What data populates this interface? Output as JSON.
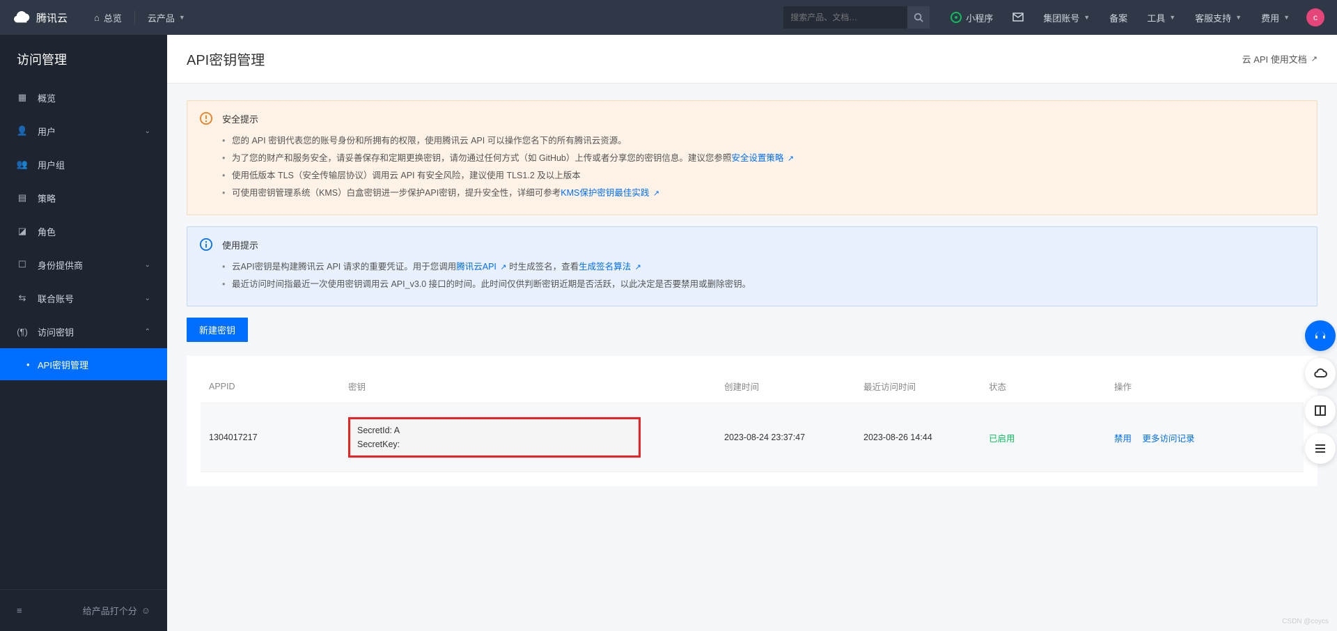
{
  "header": {
    "brand": "腾讯云",
    "overview": "总览",
    "products": "云产品",
    "search_placeholder": "搜索产品、文档…",
    "miniapp": "小程序",
    "group_account": "集团账号",
    "filing": "备案",
    "tools": "工具",
    "support": "客服支持",
    "cost": "费用",
    "avatar_letter": "c"
  },
  "sidebar": {
    "title": "访问管理",
    "items": {
      "overview": "概览",
      "users": "用户",
      "user_groups": "用户组",
      "policies": "策略",
      "roles": "角色",
      "idp": "身份提供商",
      "federated": "联合账号",
      "access_key": "访问密钥",
      "api_key_mgmt": "API密钥管理"
    },
    "footer_rate": "给产品打个分",
    "collapse_icon": "≡"
  },
  "page": {
    "title": "API密钥管理",
    "doc_link": "云 API 使用文档"
  },
  "warn_alert": {
    "title": "安全提示",
    "l1": "您的 API 密钥代表您的账号身份和所拥有的权限，使用腾讯云 API 可以操作您名下的所有腾讯云资源。",
    "l2a": "为了您的财产和服务安全，请妥善保存和定期更换密钥，请勿通过任何方式（如 GitHub）上传或者分享您的密钥信息。建议您参照",
    "l2link": "安全设置策略",
    "l3": "使用低版本 TLS（安全传输层协议）调用云 API 有安全风险，建议使用 TLS1.2 及以上版本",
    "l4a": "可使用密钥管理系统（KMS）白盒密钥进一步保护API密钥，提升安全性，详细可参考",
    "l4link": "KMS保护密钥最佳实践"
  },
  "info_alert": {
    "title": "使用提示",
    "l1a": "云API密钥是构建腾讯云 API 请求的重要凭证。用于您调用",
    "l1link1": "腾讯云API",
    "l1b": "时生成签名，查看",
    "l1link2": "生成签名算法",
    "l2": "最近访问时间指最近一次使用密钥调用云 API_v3.0 接口的时间。此时间仅供判断密钥近期是否活跃，以此决定是否要禁用或删除密钥。"
  },
  "button_new": "新建密钥",
  "table": {
    "headers": {
      "appid": "APPID",
      "key": "密钥",
      "created": "创建时间",
      "last_access": "最近访问时间",
      "status": "状态",
      "actions": "操作"
    },
    "row": {
      "appid": "1304017217",
      "secret_id_label": "SecretId: A",
      "secret_key_label": "SecretKey:",
      "created": "2023-08-24 23:37:47",
      "last_access": "2023-08-26 14:44",
      "status": "已启用",
      "action_disable": "禁用",
      "action_more": "更多访问记录"
    }
  },
  "watermark": "CSDN @coycs"
}
